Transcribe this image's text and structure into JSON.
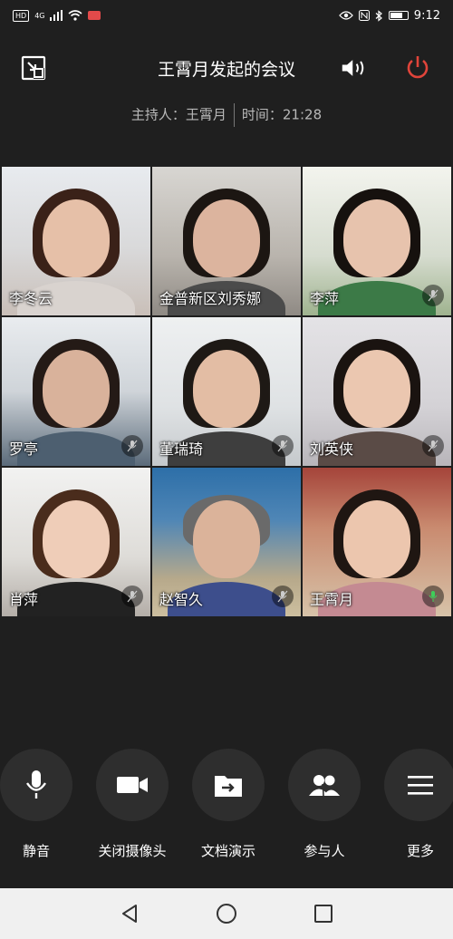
{
  "status_bar": {
    "hd_label": "HD",
    "network": "4G",
    "time": "9:12",
    "battery_level": 0.7
  },
  "header": {
    "title": "王霄月发起的会议",
    "host_label": "主持人：王霄月",
    "time_label": "时间：21:28"
  },
  "participants": [
    {
      "name": "李冬云",
      "muted": false
    },
    {
      "name": "金普新区刘秀娜",
      "muted": false
    },
    {
      "name": "李萍",
      "muted": true
    },
    {
      "name": "罗亭",
      "muted": true
    },
    {
      "name": "董瑞琦",
      "muted": true
    },
    {
      "name": "刘英侠",
      "muted": true
    },
    {
      "name": "肖萍",
      "muted": true
    },
    {
      "name": "赵智久",
      "muted": true
    },
    {
      "name": "王霄月",
      "muted": false
    }
  ],
  "toolbar": {
    "mute_label": "静音",
    "camera_label": "关闭摄像头",
    "share_label": "文档演示",
    "participants_label": "参与人",
    "more_label": "更多"
  },
  "colors": {
    "background": "#1f1f1f",
    "power_red": "#e0443a",
    "tool_circle": "#2e2e2e"
  }
}
